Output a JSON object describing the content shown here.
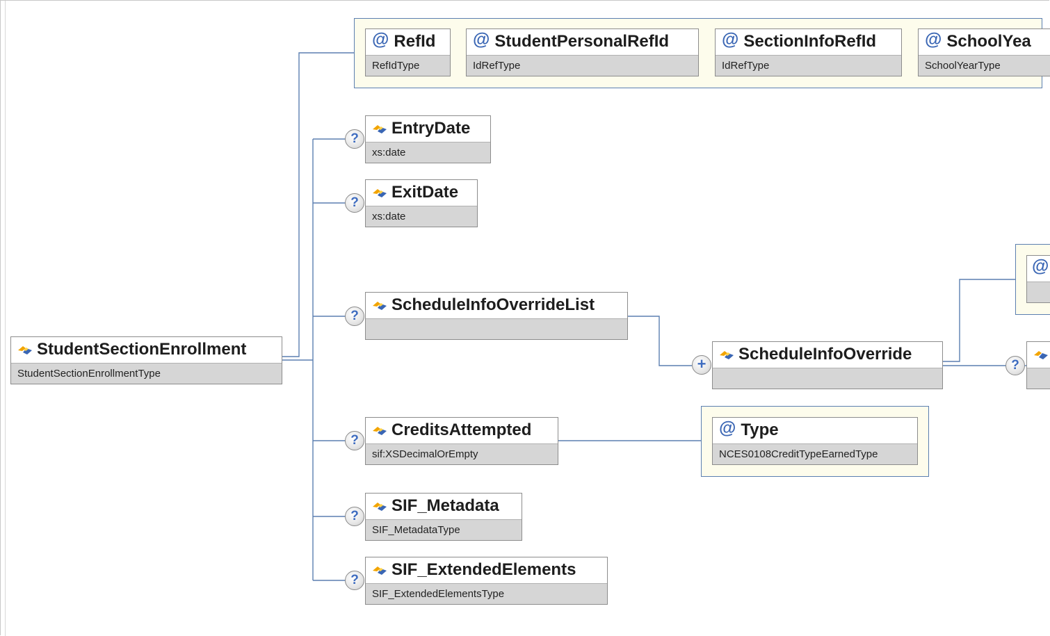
{
  "colors": {
    "wire": "#5b7fb0",
    "attribute_panel": "#fdfcec",
    "type_bar": "#d6d6d6",
    "icon_orange": "#f2a400",
    "icon_blue": "#3a66b4"
  },
  "root": {
    "name": "StudentSectionEnrollment",
    "type": "StudentSectionEnrollmentType",
    "icon": "element-icon"
  },
  "attributes": [
    {
      "name": "RefId",
      "type": "RefIdType",
      "icon": "attribute-at-icon"
    },
    {
      "name": "StudentPersonalRefId",
      "type": "IdRefType",
      "icon": "attribute-at-icon"
    },
    {
      "name": "SectionInfoRefId",
      "type": "IdRefType",
      "icon": "attribute-at-icon"
    },
    {
      "name": "SchoolYea",
      "type": "SchoolYearType",
      "icon": "attribute-at-icon"
    }
  ],
  "elements": [
    {
      "name": "EntryDate",
      "type": "xs:date",
      "occurrence": "?"
    },
    {
      "name": "ExitDate",
      "type": "xs:date",
      "occurrence": "?"
    },
    {
      "name": "ScheduleInfoOverrideList",
      "type": "",
      "occurrence": "?"
    },
    {
      "name": "CreditsAttempted",
      "type": "sif:XSDecimalOrEmpty",
      "occurrence": "?"
    },
    {
      "name": "SIF_Metadata",
      "type": "SIF_MetadataType",
      "occurrence": "?"
    },
    {
      "name": "SIF_ExtendedElements",
      "type": "SIF_ExtendedElementsType",
      "occurrence": "?"
    }
  ],
  "schedule_override": {
    "name": "ScheduleInfoOverride",
    "type": "",
    "occurrence": "+"
  },
  "credits_attribute": {
    "name": "Type",
    "type": "NCES0108CreditTypeEarnedType"
  }
}
